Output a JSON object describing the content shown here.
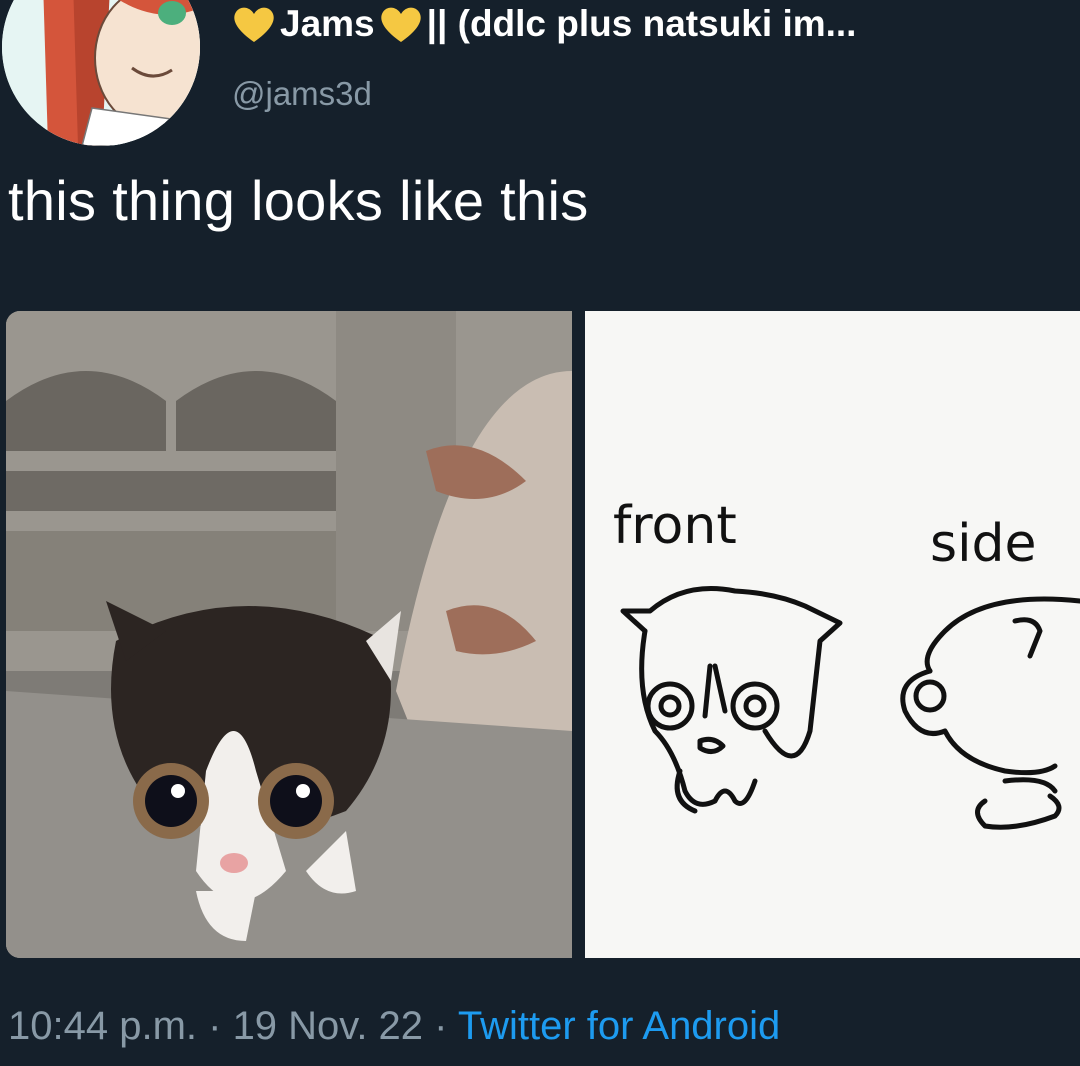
{
  "tweet": {
    "author": {
      "name_text": "Jams",
      "name_suffix": "|| (ddlc plus natsuki im...",
      "handle": "@jams3d"
    },
    "text": "this thing looks like this",
    "media": {
      "drawing_labels": {
        "front": "front",
        "side": "side"
      }
    },
    "footer": {
      "time": "10:44 p.m.",
      "sep1": " · ",
      "date": "19 Nov. 22",
      "sep2": " · ",
      "source": "Twitter for Android"
    }
  },
  "colors": {
    "background": "#15202b",
    "text_primary": "#ffffff",
    "text_secondary": "#8899a6",
    "link": "#1d9bf0",
    "heart": "#f5c842"
  }
}
